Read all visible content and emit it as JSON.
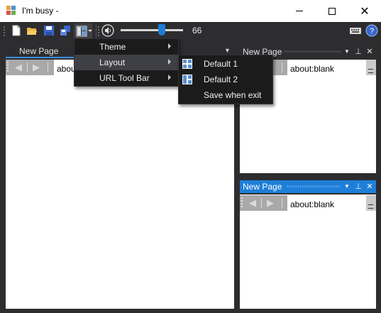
{
  "window": {
    "title": "I'm busy -",
    "minimize_glyph": "",
    "close_glyph": "✕"
  },
  "toolbar": {
    "icons": [
      "new-file-icon",
      "open-folder-icon",
      "save-icon",
      "save-all-icon",
      "layout-icon",
      "volume-icon",
      "keyboard-icon",
      "help-icon"
    ],
    "volume_value": "66",
    "volume_level_fraction": 0.66
  },
  "left_document": {
    "tab_label": "New Page",
    "dropdown_glyph": "▼",
    "url_value": "about:blank",
    "back_glyph": "◀",
    "forward_glyph": "▶"
  },
  "right_top_pane": {
    "title": "New Page",
    "url_value": "about:blank",
    "dropdown_glyph": "▼",
    "pin_glyph": "⊥",
    "close_glyph": "✕",
    "back_glyph": "◀",
    "forward_glyph": "▶"
  },
  "right_bottom_pane": {
    "title": "New Page",
    "url_value": "about:blank",
    "dropdown_glyph": "▼",
    "pin_glyph": "⊥",
    "close_glyph": "✕",
    "back_glyph": "◀",
    "forward_glyph": "▶"
  },
  "main_menu": {
    "items": [
      {
        "label": "Theme",
        "has_submenu": true
      },
      {
        "label": "Layout",
        "has_submenu": true,
        "highlighted": true
      },
      {
        "label": "URL Tool Bar",
        "has_submenu": true
      }
    ]
  },
  "layout_submenu": {
    "items": [
      {
        "label": "Default 1",
        "icon": "layout-default1-icon"
      },
      {
        "label": "Default 2",
        "icon": "layout-default2-icon"
      },
      {
        "label": "Save when exit",
        "icon": ""
      }
    ]
  },
  "colors": {
    "accent": "#1e7fd8",
    "background": "#2d2d30",
    "menu_bg": "#1b1b1c",
    "menu_hover": "#3f3f46"
  }
}
